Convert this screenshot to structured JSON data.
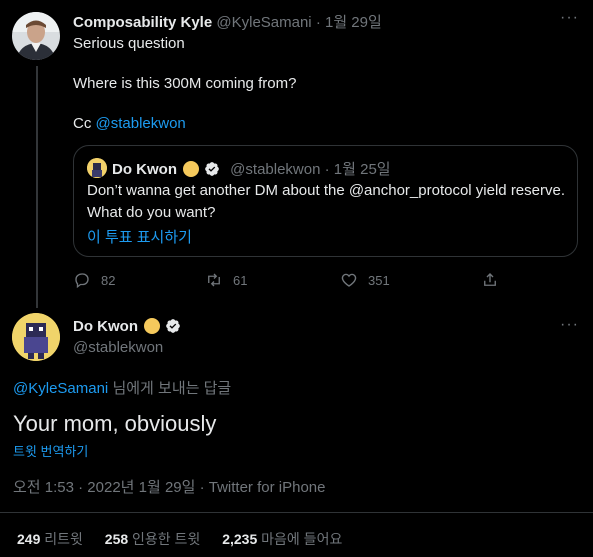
{
  "tweet1": {
    "author_name": "Composability Kyle",
    "handle": "@KyleSamani",
    "separator": "·",
    "date": "1월 29일",
    "line1": "Serious question",
    "line2": "Where is this 300M coming from?",
    "line3_prefix": "Cc ",
    "mention": "@stablekwon",
    "quoted": {
      "author_name": "Do Kwon",
      "handle": "@stablekwon",
      "separator": "·",
      "date": "1월 25일",
      "text_line1": "Don’t wanna get another DM about the @anchor_protocol yield reserve.",
      "text_line2": "What do you want?",
      "poll_link": "이 투표 표시하기"
    },
    "actions": {
      "reply_count": "82",
      "retweet_count": "61",
      "like_count": "351"
    }
  },
  "tweet2": {
    "author_name": "Do Kwon",
    "handle": "@stablekwon",
    "reply_to_mention": "@KyleSamani",
    "reply_to_suffix": " 님에게 보내는 답글",
    "text": "Your mom, obviously",
    "translate": "트윗 번역하기",
    "timestamp": "오전 1:53 · 2022년 1월 29일 · Twitter for iPhone",
    "stats": {
      "retweets_value": "249",
      "retweets_label": "리트윗",
      "quotes_value": "258",
      "quotes_label": "인용한 트윗",
      "likes_value": "2,235",
      "likes_label": "마음에 들어요"
    }
  },
  "more_glyph": "···",
  "colors": {
    "background": "#000000",
    "text": "#e7e9ea",
    "muted": "#71767b",
    "link": "#1d9bf0",
    "border": "#2f3336"
  },
  "icons": [
    "more-icon",
    "verified-icon",
    "gold-badge-icon",
    "reply-icon",
    "retweet-icon",
    "like-icon",
    "share-icon"
  ]
}
